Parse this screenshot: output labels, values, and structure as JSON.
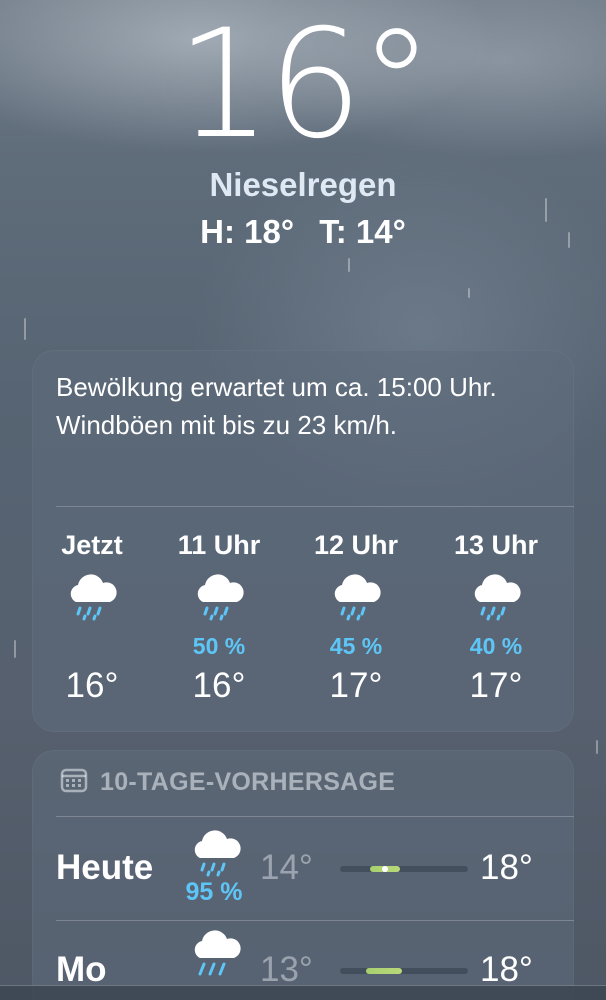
{
  "current": {
    "temperature": "16°",
    "condition": "Nieselregen",
    "high": "H: 18°",
    "low": "T: 14°"
  },
  "hourly_card": {
    "summary": "Bewölkung erwartet um ca. 15:00 Uhr. Windböen mit bis zu 23 km/h.",
    "hours": [
      {
        "label": "Jetzt",
        "icon": "cloud-drizzle-icon",
        "precip": "",
        "temp": "16°"
      },
      {
        "label": "11 Uhr",
        "icon": "cloud-drizzle-icon",
        "precip": "50 %",
        "temp": "16°"
      },
      {
        "label": "12 Uhr",
        "icon": "cloud-drizzle-icon",
        "precip": "45 %",
        "temp": "17°"
      },
      {
        "label": "13 Uhr",
        "icon": "cloud-drizzle-icon",
        "precip": "40 %",
        "temp": "17°"
      }
    ]
  },
  "forecast_card": {
    "header_icon": "calendar-icon",
    "header": "10-TAGE-VORHERSAGE",
    "days": [
      {
        "name": "Heute",
        "icon": "cloud-drizzle-icon",
        "precip": "95 %",
        "low": "14°",
        "high": "18°"
      },
      {
        "name": "Mo",
        "icon": "cloud-rain-icon",
        "precip": "",
        "low": "13°",
        "high": "18°"
      }
    ]
  },
  "colors": {
    "precip_text": "#5ec6f7",
    "temp_bar": "#a7d06f"
  }
}
